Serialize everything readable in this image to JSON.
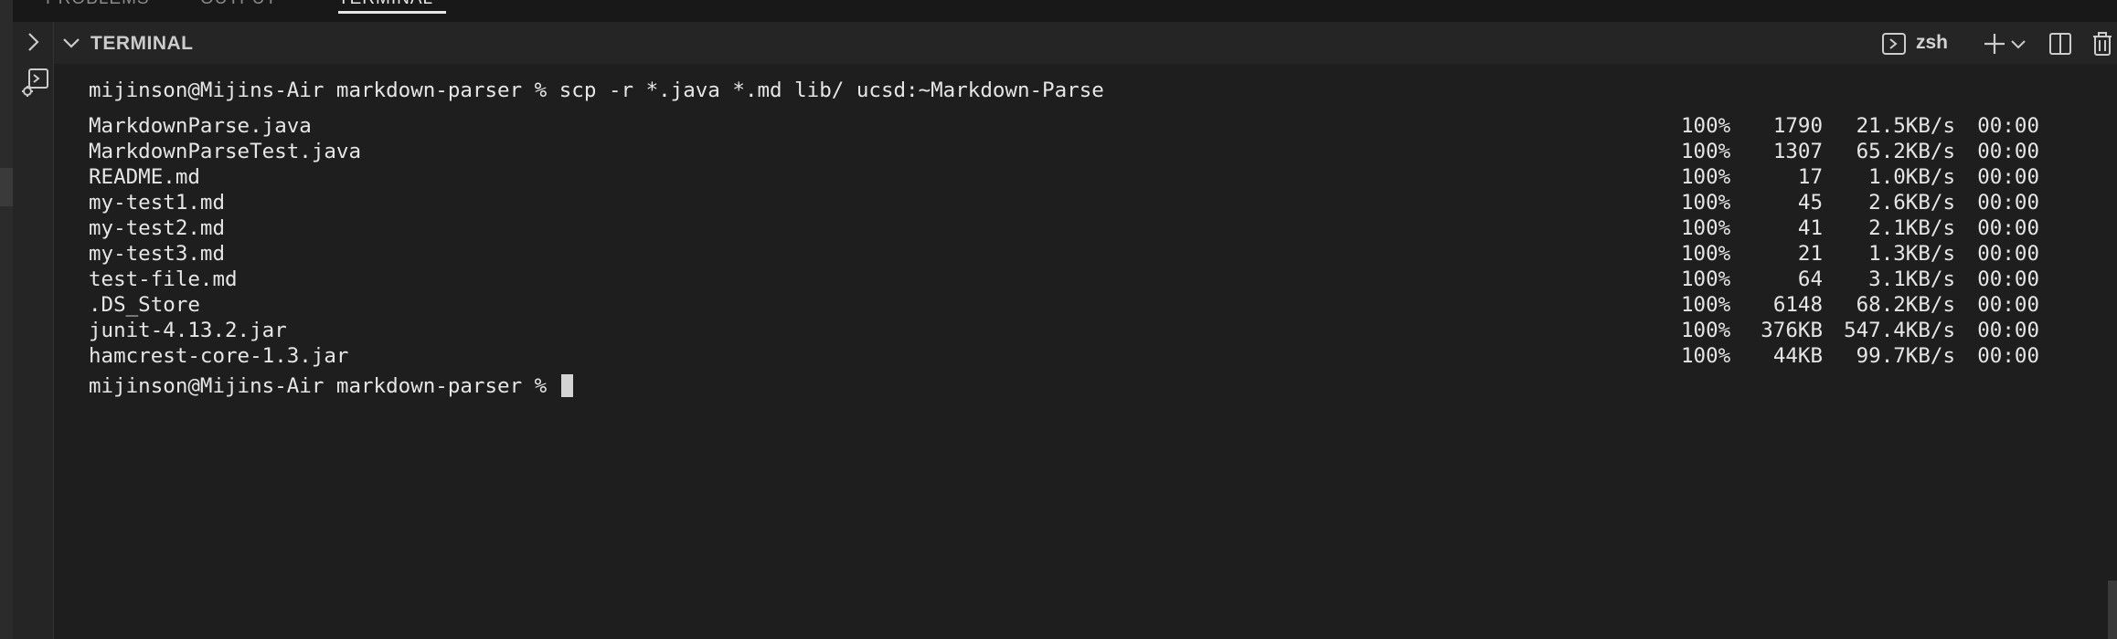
{
  "tabs": [
    {
      "label": "PROBLEMS",
      "active": false
    },
    {
      "label": "OUTPUT",
      "active": false
    },
    {
      "label": "TERMINAL",
      "active": true
    }
  ],
  "panel": {
    "title": "TERMINAL",
    "shell": "zsh",
    "icons": [
      "chevron-down-icon",
      "terminal-icon",
      "plus-icon",
      "split-icon",
      "trash-icon"
    ]
  },
  "sidebar": {
    "icons": [
      "chevron-right-icon",
      "terminal-debug-icon"
    ]
  },
  "terminal": {
    "command_line": "mijinson@Mijins-Air markdown-parser % scp -r *.java *.md lib/ ucsd:~Markdown-Parse",
    "transfers": [
      {
        "file": "MarkdownParse.java",
        "percent": "100%",
        "size": "1790",
        "rate": "21.5KB/s",
        "time": "00:00"
      },
      {
        "file": "MarkdownParseTest.java",
        "percent": "100%",
        "size": "1307",
        "rate": "65.2KB/s",
        "time": "00:00"
      },
      {
        "file": "README.md",
        "percent": "100%",
        "size": "17",
        "rate": "1.0KB/s",
        "time": "00:00"
      },
      {
        "file": "my-test1.md",
        "percent": "100%",
        "size": "45",
        "rate": "2.6KB/s",
        "time": "00:00"
      },
      {
        "file": "my-test2.md",
        "percent": "100%",
        "size": "41",
        "rate": "2.1KB/s",
        "time": "00:00"
      },
      {
        "file": "my-test3.md",
        "percent": "100%",
        "size": "21",
        "rate": "1.3KB/s",
        "time": "00:00"
      },
      {
        "file": "test-file.md",
        "percent": "100%",
        "size": "64",
        "rate": "3.1KB/s",
        "time": "00:00"
      },
      {
        "file": ".DS_Store",
        "percent": "100%",
        "size": "6148",
        "rate": "68.2KB/s",
        "time": "00:00"
      },
      {
        "file": "junit-4.13.2.jar",
        "percent": "100%",
        "size": "376KB",
        "rate": "547.4KB/s",
        "time": "00:00"
      },
      {
        "file": "hamcrest-core-1.3.jar",
        "percent": "100%",
        "size": "44KB",
        "rate": "99.7KB/s",
        "time": "00:00"
      }
    ],
    "prompt": "mijinson@Mijins-Air markdown-parser %"
  },
  "colors": {
    "background": "#1e1e1e",
    "panel_header": "#252526",
    "text": "#e6e6e6",
    "muted": "#cccccc"
  }
}
